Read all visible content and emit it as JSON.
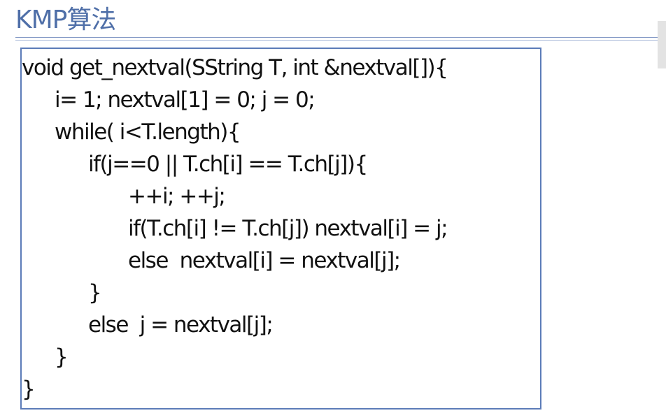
{
  "slide": {
    "title": "KMP算法"
  },
  "code": {
    "lines": [
      "void get_nextval(SString T, int &nextval[]){",
      "i= 1; nextval[1] = 0; j = 0;",
      "while( i<T.length){",
      "if(j==0 || T.ch[i] == T.ch[j]){",
      "++i; ++j;",
      "if(T.ch[i] != T.ch[j]) nextval[i] = j;",
      "else  nextval[i] = nextval[j];",
      "}",
      "else  j = nextval[j];",
      "}",
      "}"
    ]
  },
  "colors": {
    "title": "#4f6fa8",
    "box_border": "#5c7cb8"
  }
}
